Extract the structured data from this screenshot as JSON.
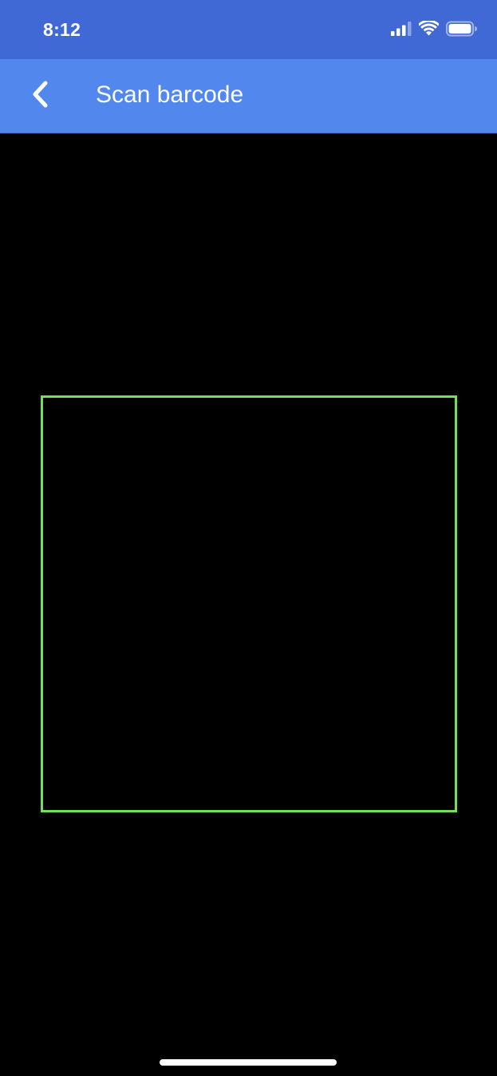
{
  "status_bar": {
    "time": "8:12",
    "icons": [
      "cellular-signal-icon",
      "wifi-icon",
      "battery-icon"
    ]
  },
  "nav_bar": {
    "back_icon": "chevron-left-icon",
    "title": "Scan barcode"
  },
  "scanner": {
    "frame_color": "#73e05c"
  },
  "colors": {
    "status_bar_bg": "#4169d6",
    "nav_bar_bg": "#5288ed",
    "camera_bg": "#000000",
    "home_indicator": "#ffffff"
  }
}
